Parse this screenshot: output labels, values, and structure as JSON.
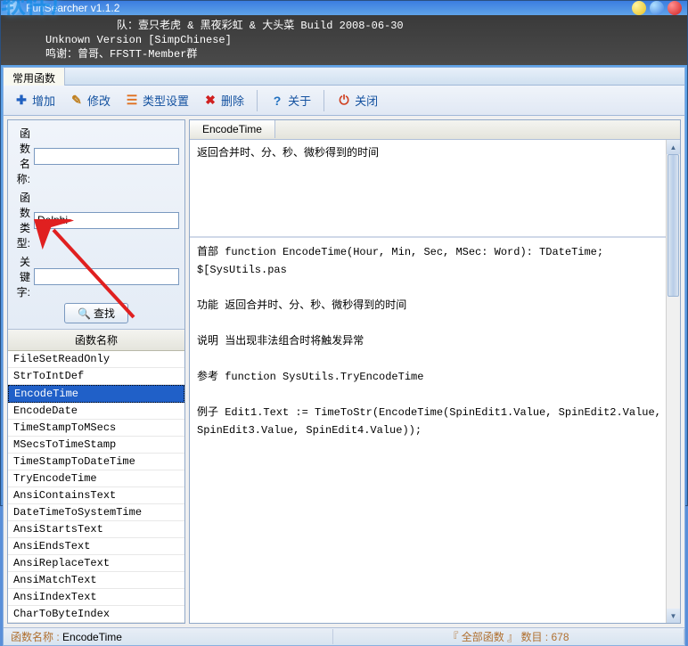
{
  "window": {
    "title": "FunSearcher v1.1.2"
  },
  "header": {
    "line1_partial": "队：壹只老虎 & 黑夜彩虹 & 大头菜  Build 2008-06-30",
    "line2": "Unknown Version [SimpChinese]",
    "line3": "鸣谢：曾哥、FFSTT-Member群",
    "watermark1": "软件厂",
    "watermark2": ""
  },
  "menu": {
    "item1": "常用函数"
  },
  "toolbar": {
    "add": "增加",
    "edit": "修改",
    "type_settings": "类型设置",
    "delete": "删除",
    "about": "关于",
    "close": "关闭"
  },
  "search": {
    "name_label": "函数名称:",
    "name_value": "",
    "type_label": "函数类型:",
    "type_value": "Delphi",
    "keyword_label": "关键字:",
    "keyword_value": "",
    "button": "查找"
  },
  "list": {
    "header": "函数名称",
    "items": [
      "FileSetReadOnly",
      "StrToIntDef",
      "EncodeTime",
      "EncodeDate",
      "TimeStampToMSecs",
      "MSecsToTimeStamp",
      "TimeStampToDateTime",
      "TryEncodeTime",
      "AnsiContainsText",
      "DateTimeToSystemTime",
      "AnsiStartsText",
      "AnsiEndsText",
      "AnsiReplaceText",
      "AnsiMatchText",
      "AnsiIndexText",
      "CharToByteIndex"
    ],
    "selected_index": 2
  },
  "detail": {
    "tab": "EncodeTime",
    "summary": "返回合并时、分、秒、微秒得到的时间",
    "body": "首部 function EncodeTime(Hour, Min, Sec, MSec: Word): TDateTime; $[SysUtils.pas\n\n功能 返回合并时、分、秒、微秒得到的时间\n\n说明 当出现非法组合时将触发异常\n\n参考 function SysUtils.TryEncodeTime\n\n例子 Edit1.Text := TimeToStr(EncodeTime(SpinEdit1.Value, SpinEdit2.Value,\nSpinEdit3.Value, SpinEdit4.Value));"
  },
  "status": {
    "name_label": "函数名称 : ",
    "name_value": "EncodeTime",
    "count_label": "『 全部函数 』 数目 : ",
    "count_value": "678"
  }
}
